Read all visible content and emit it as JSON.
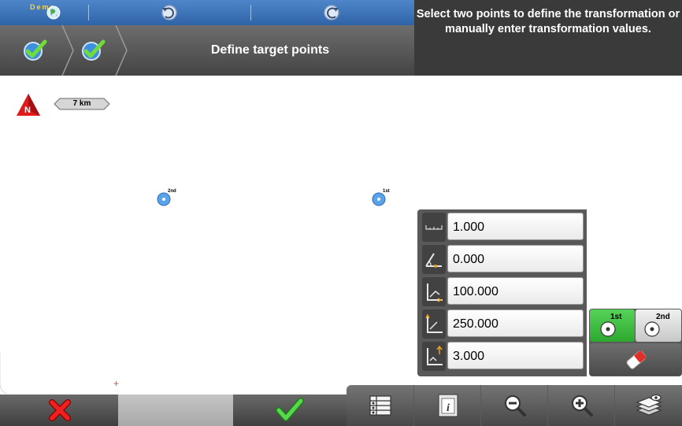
{
  "header": {
    "demo_label": "Demo",
    "title": "Define target points",
    "instruction": "Select two points to define the transformation or manually enter transformation values."
  },
  "map": {
    "north_label": "N",
    "scale_label": "7 km",
    "points": [
      {
        "label": "2nd"
      },
      {
        "label": "1st"
      }
    ]
  },
  "transform": {
    "scale": "1.000",
    "rotation": "0.000",
    "offset_x": "100.000",
    "offset_y": "250.000",
    "offset_z": "3.000"
  },
  "point_selector": {
    "first_label": "1st",
    "second_label": "2nd",
    "active": "1st"
  },
  "colors": {
    "accent_blue": "#3a72b8",
    "confirm_green": "#3ab83c",
    "cancel_red": "#e02020"
  },
  "icons": {
    "demo": "globe-icon",
    "undo": "undo-icon",
    "redo": "redo-icon",
    "step_done": "check-icon",
    "cancel": "close-icon",
    "confirm": "check-icon",
    "toolbar": [
      "table-icon",
      "info-icon",
      "zoom-out-icon",
      "zoom-in-icon",
      "layers-icon"
    ]
  }
}
